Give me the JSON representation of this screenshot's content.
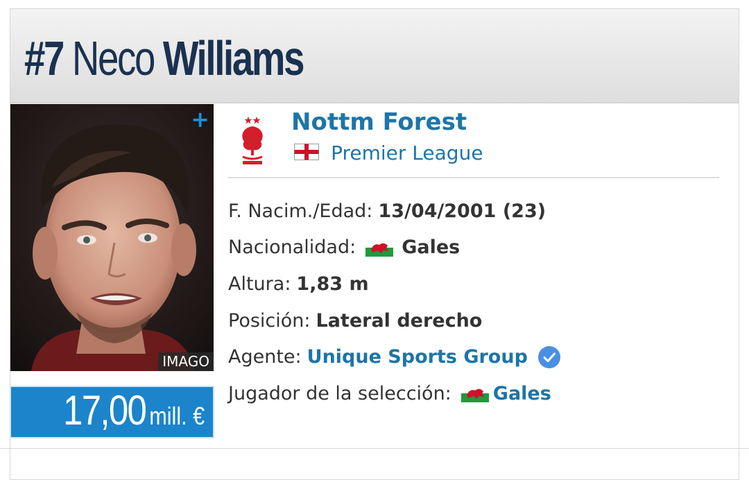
{
  "header": {
    "number": "#7",
    "first_name": "Neco",
    "last_name": "Williams"
  },
  "photo": {
    "plus_label": "+",
    "credit": "IMAGO"
  },
  "market_value": {
    "amount": "17,00",
    "unit": "mill. €",
    "background_color": "#1b84cb"
  },
  "club": {
    "name": "Nottm Forest",
    "league": "Premier League",
    "league_flag_icon": "england-flag-icon",
    "logo_icon": "nottingham-forest-crest-icon"
  },
  "info": {
    "birth_label": "F. Nacim./Edad:",
    "birth_value": "13/04/2001 (23)",
    "nationality_label": "Nacionalidad:",
    "nationality_value": "Gales",
    "height_label": "Altura:",
    "height_value": "1,83 m",
    "position_label": "Posición:",
    "position_value": "Lateral derecho",
    "agent_label": "Agente:",
    "agent_value": "Unique Sports Group",
    "national_label": "Jugador de la selección:",
    "national_value": "Gales"
  },
  "colors": {
    "title": "#1a3151",
    "link": "#1d75a8",
    "verified": "#4a90e2"
  }
}
